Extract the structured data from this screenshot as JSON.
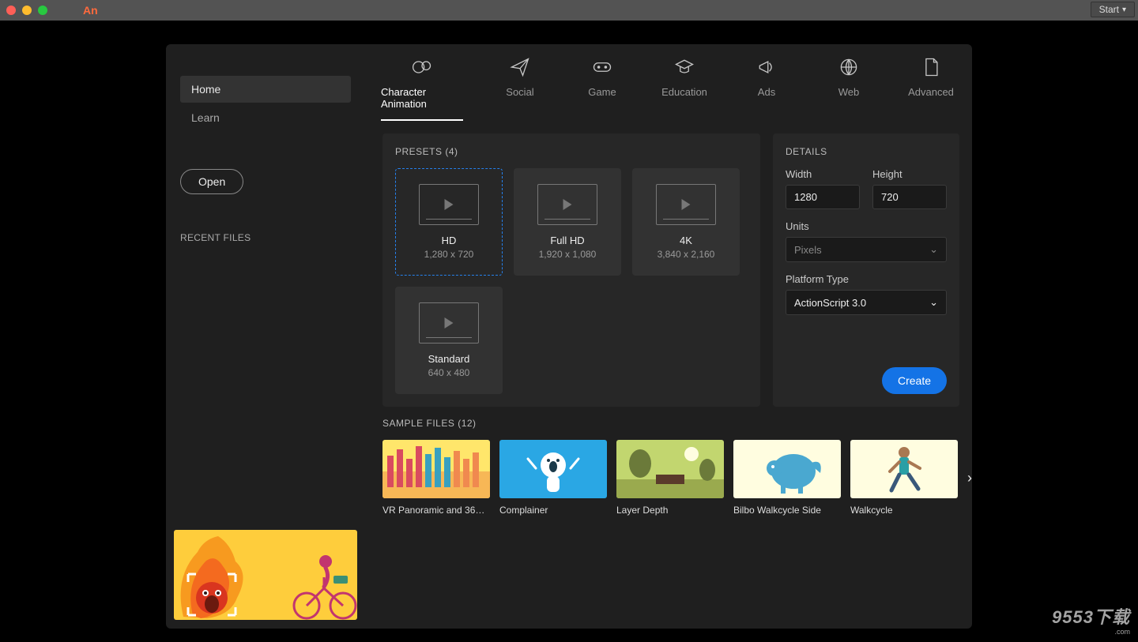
{
  "titlebar": {
    "app": "An",
    "start": "Start"
  },
  "sidebar": {
    "items": [
      {
        "label": "Home",
        "active": true
      },
      {
        "label": "Learn",
        "active": false
      }
    ],
    "open": "Open",
    "recent": "RECENT FILES"
  },
  "tabs": [
    {
      "label": "Character Animation",
      "icon": "characters",
      "active": true
    },
    {
      "label": "Social",
      "icon": "plane",
      "active": false
    },
    {
      "label": "Game",
      "icon": "gamepad",
      "active": false
    },
    {
      "label": "Education",
      "icon": "gradcap",
      "active": false
    },
    {
      "label": "Ads",
      "icon": "megaphone",
      "active": false
    },
    {
      "label": "Web",
      "icon": "globe",
      "active": false
    },
    {
      "label": "Advanced",
      "icon": "page",
      "active": false
    }
  ],
  "presets": {
    "title": "PRESETS (4)",
    "items": [
      {
        "name": "HD",
        "dims": "1,280 x 720",
        "selected": true
      },
      {
        "name": "Full HD",
        "dims": "1,920 x 1,080",
        "selected": false
      },
      {
        "name": "4K",
        "dims": "3,840 x 2,160",
        "selected": false
      },
      {
        "name": "Standard",
        "dims": "640 x 480",
        "selected": false
      }
    ]
  },
  "details": {
    "title": "DETAILS",
    "width_label": "Width",
    "width_value": "1280",
    "height_label": "Height",
    "height_value": "720",
    "units_label": "Units",
    "units_value": "Pixels",
    "platform_label": "Platform Type",
    "platform_value": "ActionScript 3.0",
    "create": "Create"
  },
  "samples": {
    "title": "SAMPLE FILES (12)",
    "items": [
      {
        "label": "VR Panoramic and 360 ..."
      },
      {
        "label": "Complainer"
      },
      {
        "label": "Layer Depth"
      },
      {
        "label": "Bilbo Walkcycle Side"
      },
      {
        "label": "Walkcycle"
      }
    ]
  },
  "watermark": {
    "main": "9553下载",
    "sub": ".com"
  }
}
